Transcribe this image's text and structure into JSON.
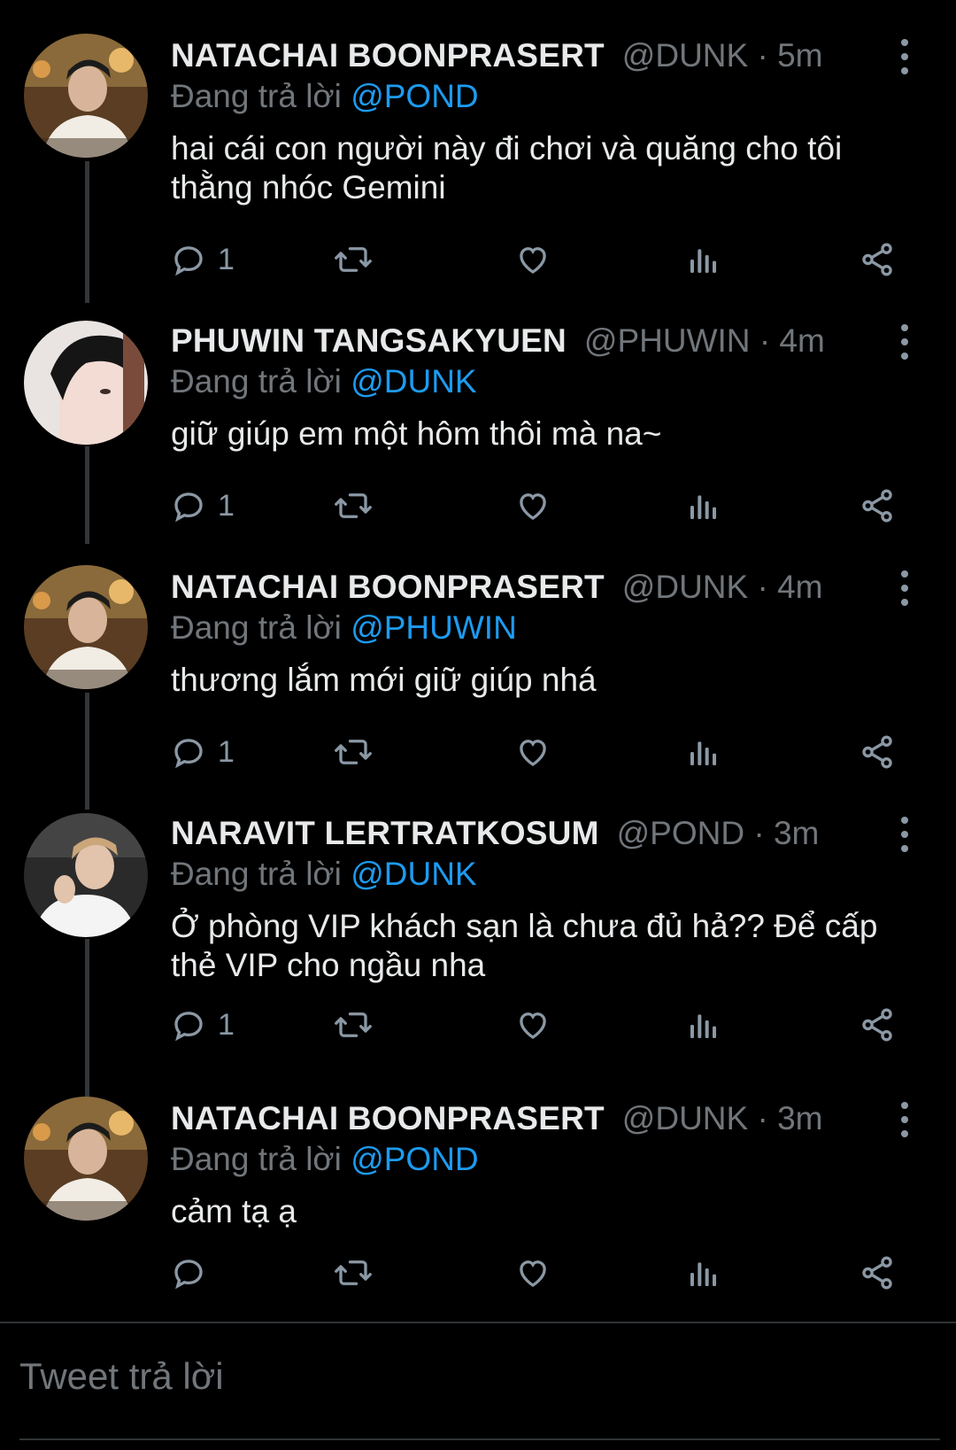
{
  "tweets": [
    {
      "name": "NATACHAI BOONPRASERT",
      "handle": "@DUNK",
      "sep": "·",
      "time": "5m",
      "replying_prefix": "Đang trả lời",
      "replying_to": "@POND",
      "text": "hai cái con người này đi chơi và quăng cho tôi thằng nhóc Gemini",
      "reply_count": "1"
    },
    {
      "name": "PHUWIN TANGSAKYUEN",
      "handle": "@PHUWIN",
      "sep": "·",
      "time": "4m",
      "replying_prefix": "Đang trả lời",
      "replying_to": "@DUNK",
      "text": "giữ giúp em một hôm thôi mà na~",
      "reply_count": "1"
    },
    {
      "name": "NATACHAI BOONPRASERT",
      "handle": "@DUNK",
      "sep": "·",
      "time": "4m",
      "replying_prefix": "Đang trả lời",
      "replying_to": "@PHUWIN",
      "text": "thương lắm mới giữ giúp nhá",
      "reply_count": "1"
    },
    {
      "name": "NARAVIT LERTRATKOSUM",
      "handle": "@POND",
      "sep": "·",
      "time": "3m",
      "replying_prefix": "Đang trả lời",
      "replying_to": "@DUNK",
      "text": "Ở phòng VIP khách sạn là chưa đủ hả?? Để cấp thẻ VIP cho ngầu nha",
      "reply_count": "1"
    },
    {
      "name": "NATACHAI BOONPRASERT",
      "handle": "@DUNK",
      "sep": "·",
      "time": "3m",
      "replying_prefix": "Đang trả lời",
      "replying_to": "@POND",
      "text": "cảm tạ ạ",
      "reply_count": ""
    }
  ],
  "composer": {
    "placeholder": "Tweet trả lời"
  },
  "icons": {
    "reply": "reply-icon",
    "retweet": "retweet-icon",
    "like": "heart-icon",
    "views": "analytics-icon",
    "share": "share-icon",
    "more": "more-icon"
  },
  "colors": {
    "background": "#000000",
    "accent": "#1d9bf0",
    "text": "#e7e9ea",
    "muted": "#71767b",
    "icon": "#8b98a5"
  }
}
